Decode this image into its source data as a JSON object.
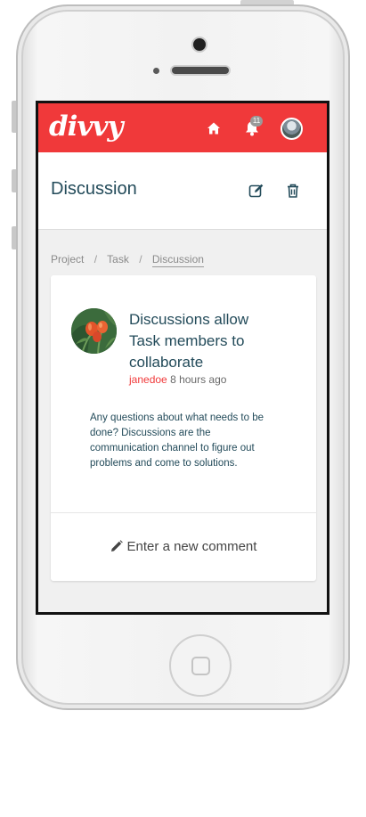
{
  "app": {
    "brand": "divvy",
    "accent_color": "#f0393a",
    "notification_count": "11"
  },
  "header": {
    "title": "Discussion",
    "home_icon": "home-icon",
    "bell_icon": "bell-icon",
    "edit_icon": "edit-icon",
    "trash_icon": "trash-icon"
  },
  "breadcrumb": {
    "items": [
      "Project",
      "Task",
      "Discussion"
    ],
    "separator": "/"
  },
  "post": {
    "title": "Discussions allow Task members to collaborate",
    "author": "janedoe",
    "time": "8 hours ago",
    "body": "Any questions about what needs to be done? Discussions are the communication channel to figure out problems and come to solutions."
  },
  "comment": {
    "label": "Enter a new comment",
    "icon": "pencil-icon"
  }
}
